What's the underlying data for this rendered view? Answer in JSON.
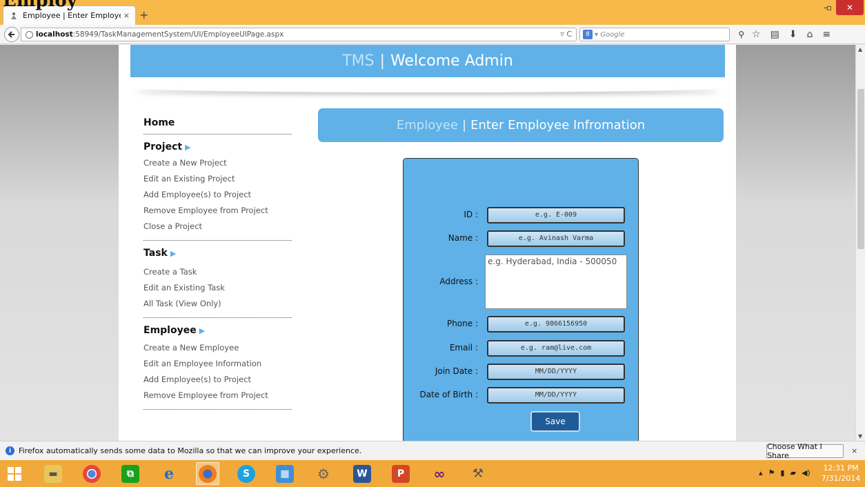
{
  "browser": {
    "heading_overlay": "Employ",
    "tab_title": "Employee | Enter Employee...",
    "tab_close": "×",
    "new_tab": "+",
    "url_host": "localhost",
    "url_path": ":58949/TaskManagementSystem/UI/EmployeeUIPage.aspx",
    "url_tail": "▿ C",
    "search_engine_icon": "8",
    "search_placeholder": "▾ Google",
    "minimize": "–",
    "maximize": "▫",
    "close": "✕"
  },
  "header": {
    "app": "TMS",
    "separator": "|",
    "welcome": "Welcome Admin"
  },
  "section": {
    "prefix": "Employee",
    "separator": "|",
    "title": "Enter Employee Infromation"
  },
  "sidebar": {
    "home": "Home",
    "project": {
      "heading": "Project",
      "links": [
        "Create a New Project",
        "Edit an Existing Project",
        "Add Employee(s) to Project",
        "Remove Employee from Project",
        "Close a Project"
      ]
    },
    "task": {
      "heading": "Task",
      "links": [
        "Create a Task",
        "Edit an Existing Task",
        "All Task (View Only)"
      ]
    },
    "employee": {
      "heading": "Employee",
      "links": [
        "Create a New Employee",
        "Edit an Employee Information",
        "Add Employee(s) to Project",
        "Remove Employee from Project"
      ]
    },
    "arrow": "▶"
  },
  "form": {
    "id": {
      "label": "ID :",
      "placeholder": "e.g. E-009"
    },
    "name": {
      "label": "Name :",
      "placeholder": "e.g. Avinash Varma"
    },
    "address": {
      "label": "Address :",
      "placeholder": "e.g. Hyderabad, India - 500050"
    },
    "phone": {
      "label": "Phone :",
      "placeholder": "e.g. 9866156950"
    },
    "email": {
      "label": "Email :",
      "placeholder": "e.g. ram@live.com"
    },
    "join_date": {
      "label": "Join Date :",
      "placeholder": "MM/DD/YYYY"
    },
    "dob": {
      "label": "Date of Birth :",
      "placeholder": "MM/DD/YYYY"
    },
    "save_label": "Save"
  },
  "notification": {
    "text": "Firefox automatically sends some data to Mozilla so that we can improve your experience.",
    "share_button": "Choose What I Share",
    "close": "×"
  },
  "taskbar": {
    "time": "12:31 PM",
    "date": "7/31/2014",
    "icons": [
      "windows-start-icon",
      "file-explorer-icon",
      "chrome-icon",
      "store-icon",
      "internet-explorer-icon",
      "firefox-icon",
      "skype-icon",
      "control-panel-icon",
      "settings-icon",
      "word-icon",
      "powerpoint-icon",
      "visual-studio-icon",
      "tools-icon"
    ]
  },
  "colors": {
    "accent": "#5fb1e8",
    "taskbar": "#f2a93b",
    "save_button": "#1f5a99"
  }
}
